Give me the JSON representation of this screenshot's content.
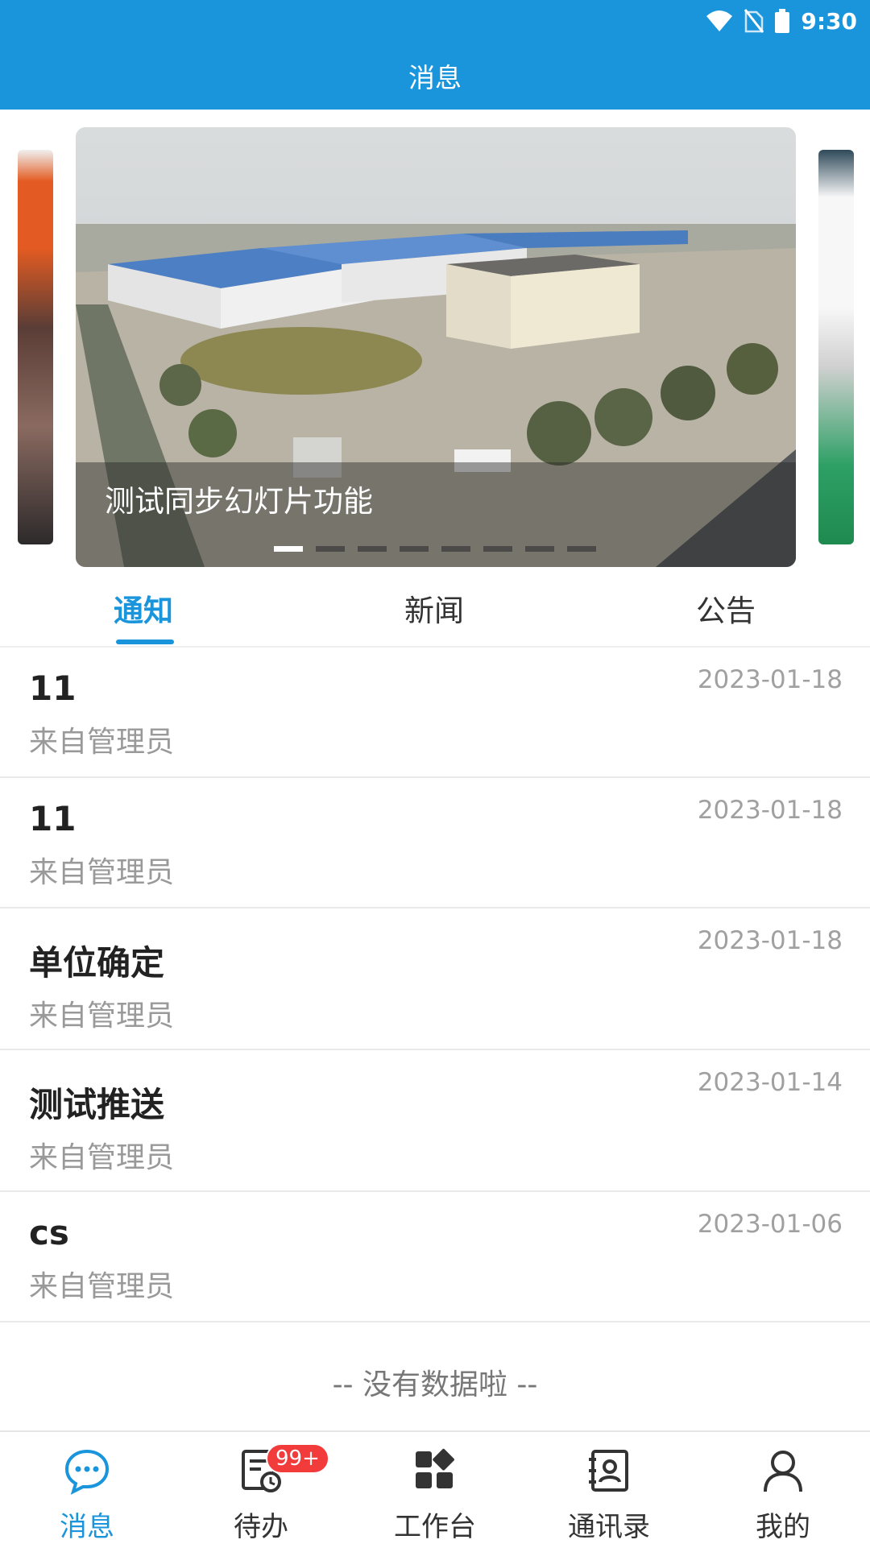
{
  "status_bar": {
    "time": "9:30"
  },
  "header": {
    "title": "消息"
  },
  "carousel": {
    "caption": "测试同步幻灯片功能",
    "dot_count": 8,
    "active_index": 0
  },
  "tabs": [
    {
      "label": "通知",
      "active": true
    },
    {
      "label": "新闻",
      "active": false
    },
    {
      "label": "公告",
      "active": false
    }
  ],
  "messages": [
    {
      "title": "11",
      "from": "来自管理员",
      "date": "2023-01-18"
    },
    {
      "title": "11",
      "from": "来自管理员",
      "date": "2023-01-18"
    },
    {
      "title": "单位确定",
      "from": "来自管理员",
      "date": "2023-01-18"
    },
    {
      "title": "测试推送",
      "from": "来自管理员",
      "date": "2023-01-14"
    },
    {
      "title": "cs",
      "from": "来自管理员",
      "date": "2023-01-06"
    }
  ],
  "list_footer": "-- 没有数据啦 --",
  "bottom_nav": [
    {
      "label": "消息",
      "icon": "chat-bubble-icon",
      "active": true
    },
    {
      "label": "待办",
      "icon": "todo-clock-icon",
      "active": false,
      "badge": "99+"
    },
    {
      "label": "工作台",
      "icon": "workbench-grid-icon",
      "active": false
    },
    {
      "label": "通讯录",
      "icon": "contacts-book-icon",
      "active": false
    },
    {
      "label": "我的",
      "icon": "person-icon",
      "active": false
    }
  ],
  "colors": {
    "brand": "#1a95dc",
    "badge": "#f23c3c"
  }
}
